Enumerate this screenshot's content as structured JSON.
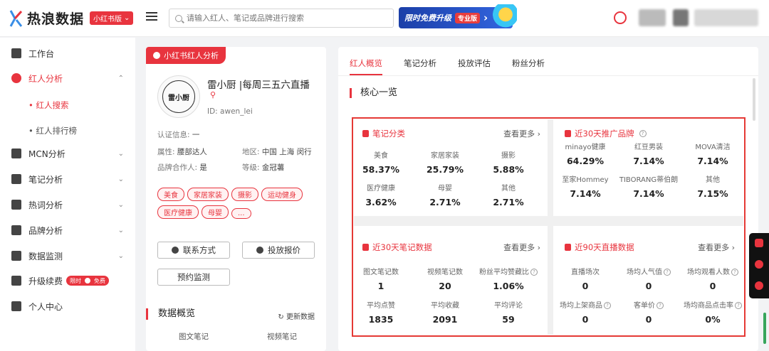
{
  "header": {
    "logo": "热浪数据",
    "edition": "小红书版",
    "search_placeholder": "请输入红人、笔记或品牌进行搜索",
    "promo_text": "限时免费升级",
    "promo_tag": "专业版"
  },
  "sidebar": {
    "items": [
      {
        "label": "工作台",
        "icon": "home-icon"
      },
      {
        "label": "红人分析",
        "icon": "flower-icon",
        "active": true
      },
      {
        "label": "MCN分析",
        "icon": "crown-icon"
      },
      {
        "label": "笔记分析",
        "icon": "book-icon"
      },
      {
        "label": "热词分析",
        "icon": "chat-icon"
      },
      {
        "label": "品牌分析",
        "icon": "medal-icon"
      },
      {
        "label": "数据监测",
        "icon": "chart-icon"
      },
      {
        "label": "升级续费",
        "icon": "upgrade-icon"
      },
      {
        "label": "个人中心",
        "icon": "user-icon"
      }
    ],
    "sub_items": [
      "• 红人搜索",
      "• 红人排行榜"
    ],
    "renew_badge": {
      "left": "限时",
      "right": "免费"
    }
  },
  "profile": {
    "tag": "小红书红人分析",
    "avatar_text": "雷小厨",
    "name": "雷小厨 |每周三五六直播",
    "id": "ID: awen_lei",
    "cert_label": "认证信息:",
    "cert_value": "一",
    "attr_label": "属性:",
    "attr_value": "腰部达人",
    "region_label": "地区:",
    "region_value": "中国 上海 闵行",
    "brand_label": "品牌合作人:",
    "brand_value": "是",
    "level_label": "等级:",
    "level_value": "金冠薯",
    "chips": [
      "美食",
      "家居家装",
      "摄影",
      "运动健身",
      "医疗健康",
      "母婴",
      "..."
    ],
    "btn_contact": "联系方式",
    "btn_price": "投放报价",
    "btn_monitor": "预约监测",
    "overview_title": "数据概览",
    "refresh": "更新数据",
    "col_image_notes": "图文笔记",
    "col_video_notes": "视频笔记"
  },
  "main": {
    "tabs": [
      "红人概览",
      "笔记分析",
      "投放评估",
      "粉丝分析"
    ],
    "core_title": "核心一览",
    "note_category": {
      "title": "笔记分类",
      "more": "查看更多",
      "stats": [
        {
          "label": "美食",
          "value": "58.37%"
        },
        {
          "label": "家居家装",
          "value": "25.79%"
        },
        {
          "label": "摄影",
          "value": "5.88%"
        },
        {
          "label": "医疗健康",
          "value": "3.62%"
        },
        {
          "label": "母婴",
          "value": "2.71%"
        },
        {
          "label": "其他",
          "value": "2.71%"
        }
      ]
    },
    "brands_30d": {
      "title": "近30天推广品牌",
      "stats": [
        {
          "label": "minayo健康",
          "value": "64.29%"
        },
        {
          "label": "红豆男装",
          "value": "7.14%"
        },
        {
          "label": "MOVA清洁",
          "value": "7.14%"
        },
        {
          "label": "至家Hommey",
          "value": "7.14%"
        },
        {
          "label": "TIBORANG蒂伯朗",
          "value": "7.14%"
        },
        {
          "label": "其他",
          "value": "7.15%"
        }
      ]
    },
    "notes_30d": {
      "title": "近30天笔记数据",
      "more": "查看更多",
      "stats": [
        {
          "label": "图文笔记数",
          "value": "1"
        },
        {
          "label": "视频笔记数",
          "value": "20"
        },
        {
          "label": "粉丝平均赞藏比",
          "value": "1.06%",
          "help": true
        },
        {
          "label": "平均点赞",
          "value": "1835"
        },
        {
          "label": "平均收藏",
          "value": "2091"
        },
        {
          "label": "平均评论",
          "value": "59"
        }
      ]
    },
    "live_90d": {
      "title": "近90天直播数据",
      "more": "查看更多",
      "stats": [
        {
          "label": "直播场次",
          "value": "0"
        },
        {
          "label": "场均人气值",
          "value": "0",
          "help": true
        },
        {
          "label": "场均观看人数",
          "value": "0",
          "help": true
        },
        {
          "label": "场均上架商品",
          "value": "0",
          "help": true
        },
        {
          "label": "客单价",
          "value": "0",
          "help": true
        },
        {
          "label": "场均商品点击率",
          "value": "0%",
          "help": true
        }
      ]
    }
  }
}
